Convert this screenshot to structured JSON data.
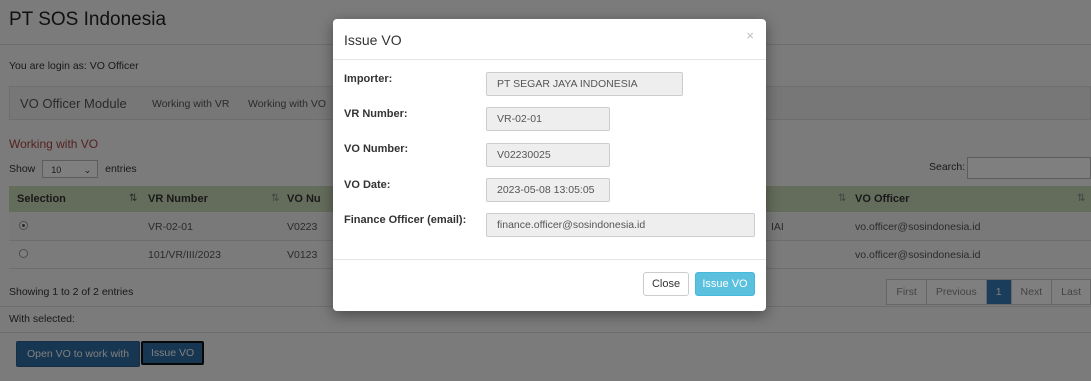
{
  "app": {
    "title": "PT SOS Indonesia",
    "login_text": "You are login as: VO Officer"
  },
  "nav": {
    "brand": "VO Officer Module",
    "links": [
      "Working with VR",
      "Working with VO"
    ]
  },
  "section": {
    "title": "Working with VO"
  },
  "list_controls": {
    "show_label": "Show",
    "entries_value": "10",
    "entries_label": "entries",
    "search_label": "Search:"
  },
  "table": {
    "headers": [
      "Selection",
      "VR Number",
      "VO Nu",
      "",
      "VO Officer"
    ],
    "rows": [
      {
        "selected": true,
        "vr_number": "VR-02-01",
        "vo_number": "V0223",
        "extra": "IAI",
        "vo_officer": "vo.officer@sosindonesia.id"
      },
      {
        "selected": false,
        "vr_number": "101/VR/III/2023",
        "vo_number": "V0123",
        "extra": "",
        "vo_officer": "vo.officer@sosindonesia.id"
      }
    ]
  },
  "info": {
    "text": "Showing 1 to 2 of 2 entries",
    "with_selected": "With selected:"
  },
  "pagination": {
    "first": "First",
    "previous": "Previous",
    "current": "1",
    "next": "Next",
    "last": "Last"
  },
  "actions": {
    "open_vo": "Open VO to work with",
    "issue_vo": "Issue VO"
  },
  "modal": {
    "title": "Issue VO",
    "close_symbol": "×",
    "fields": {
      "importer_label": "Importer:",
      "importer_value": "PT SEGAR JAYA INDONESIA",
      "vr_label": "VR Number:",
      "vr_value": "VR-02-01",
      "vo_label": "VO Number:",
      "vo_value": "V02230025",
      "date_label": "VO Date:",
      "date_value": "2023-05-08 13:05:05",
      "finance_label": "Finance Officer (email):",
      "finance_value": "finance.officer@sosindonesia.id"
    },
    "close_button": "Close",
    "issue_button": "Issue VO"
  },
  "colors": {
    "header_green": "#c8d9b8",
    "primary": "#337ab7",
    "info": "#5bc0de",
    "section_red": "#a94442"
  }
}
